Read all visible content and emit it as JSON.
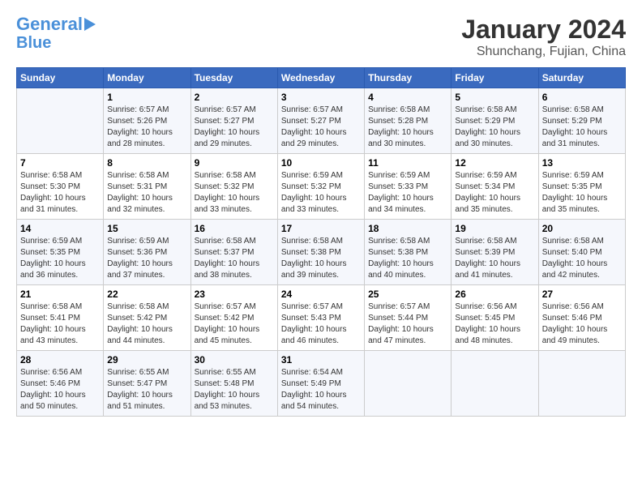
{
  "logo": {
    "line1": "General",
    "line2": "Blue"
  },
  "title": "January 2024",
  "subtitle": "Shunchang, Fujian, China",
  "days_header": [
    "Sunday",
    "Monday",
    "Tuesday",
    "Wednesday",
    "Thursday",
    "Friday",
    "Saturday"
  ],
  "weeks": [
    [
      {
        "num": "",
        "info": ""
      },
      {
        "num": "1",
        "info": "Sunrise: 6:57 AM\nSunset: 5:26 PM\nDaylight: 10 hours\nand 28 minutes."
      },
      {
        "num": "2",
        "info": "Sunrise: 6:57 AM\nSunset: 5:27 PM\nDaylight: 10 hours\nand 29 minutes."
      },
      {
        "num": "3",
        "info": "Sunrise: 6:57 AM\nSunset: 5:27 PM\nDaylight: 10 hours\nand 29 minutes."
      },
      {
        "num": "4",
        "info": "Sunrise: 6:58 AM\nSunset: 5:28 PM\nDaylight: 10 hours\nand 30 minutes."
      },
      {
        "num": "5",
        "info": "Sunrise: 6:58 AM\nSunset: 5:29 PM\nDaylight: 10 hours\nand 30 minutes."
      },
      {
        "num": "6",
        "info": "Sunrise: 6:58 AM\nSunset: 5:29 PM\nDaylight: 10 hours\nand 31 minutes."
      }
    ],
    [
      {
        "num": "7",
        "info": "Sunrise: 6:58 AM\nSunset: 5:30 PM\nDaylight: 10 hours\nand 31 minutes."
      },
      {
        "num": "8",
        "info": "Sunrise: 6:58 AM\nSunset: 5:31 PM\nDaylight: 10 hours\nand 32 minutes."
      },
      {
        "num": "9",
        "info": "Sunrise: 6:58 AM\nSunset: 5:32 PM\nDaylight: 10 hours\nand 33 minutes."
      },
      {
        "num": "10",
        "info": "Sunrise: 6:59 AM\nSunset: 5:32 PM\nDaylight: 10 hours\nand 33 minutes."
      },
      {
        "num": "11",
        "info": "Sunrise: 6:59 AM\nSunset: 5:33 PM\nDaylight: 10 hours\nand 34 minutes."
      },
      {
        "num": "12",
        "info": "Sunrise: 6:59 AM\nSunset: 5:34 PM\nDaylight: 10 hours\nand 35 minutes."
      },
      {
        "num": "13",
        "info": "Sunrise: 6:59 AM\nSunset: 5:35 PM\nDaylight: 10 hours\nand 35 minutes."
      }
    ],
    [
      {
        "num": "14",
        "info": "Sunrise: 6:59 AM\nSunset: 5:35 PM\nDaylight: 10 hours\nand 36 minutes."
      },
      {
        "num": "15",
        "info": "Sunrise: 6:59 AM\nSunset: 5:36 PM\nDaylight: 10 hours\nand 37 minutes."
      },
      {
        "num": "16",
        "info": "Sunrise: 6:58 AM\nSunset: 5:37 PM\nDaylight: 10 hours\nand 38 minutes."
      },
      {
        "num": "17",
        "info": "Sunrise: 6:58 AM\nSunset: 5:38 PM\nDaylight: 10 hours\nand 39 minutes."
      },
      {
        "num": "18",
        "info": "Sunrise: 6:58 AM\nSunset: 5:38 PM\nDaylight: 10 hours\nand 40 minutes."
      },
      {
        "num": "19",
        "info": "Sunrise: 6:58 AM\nSunset: 5:39 PM\nDaylight: 10 hours\nand 41 minutes."
      },
      {
        "num": "20",
        "info": "Sunrise: 6:58 AM\nSunset: 5:40 PM\nDaylight: 10 hours\nand 42 minutes."
      }
    ],
    [
      {
        "num": "21",
        "info": "Sunrise: 6:58 AM\nSunset: 5:41 PM\nDaylight: 10 hours\nand 43 minutes."
      },
      {
        "num": "22",
        "info": "Sunrise: 6:58 AM\nSunset: 5:42 PM\nDaylight: 10 hours\nand 44 minutes."
      },
      {
        "num": "23",
        "info": "Sunrise: 6:57 AM\nSunset: 5:42 PM\nDaylight: 10 hours\nand 45 minutes."
      },
      {
        "num": "24",
        "info": "Sunrise: 6:57 AM\nSunset: 5:43 PM\nDaylight: 10 hours\nand 46 minutes."
      },
      {
        "num": "25",
        "info": "Sunrise: 6:57 AM\nSunset: 5:44 PM\nDaylight: 10 hours\nand 47 minutes."
      },
      {
        "num": "26",
        "info": "Sunrise: 6:56 AM\nSunset: 5:45 PM\nDaylight: 10 hours\nand 48 minutes."
      },
      {
        "num": "27",
        "info": "Sunrise: 6:56 AM\nSunset: 5:46 PM\nDaylight: 10 hours\nand 49 minutes."
      }
    ],
    [
      {
        "num": "28",
        "info": "Sunrise: 6:56 AM\nSunset: 5:46 PM\nDaylight: 10 hours\nand 50 minutes."
      },
      {
        "num": "29",
        "info": "Sunrise: 6:55 AM\nSunset: 5:47 PM\nDaylight: 10 hours\nand 51 minutes."
      },
      {
        "num": "30",
        "info": "Sunrise: 6:55 AM\nSunset: 5:48 PM\nDaylight: 10 hours\nand 53 minutes."
      },
      {
        "num": "31",
        "info": "Sunrise: 6:54 AM\nSunset: 5:49 PM\nDaylight: 10 hours\nand 54 minutes."
      },
      {
        "num": "",
        "info": ""
      },
      {
        "num": "",
        "info": ""
      },
      {
        "num": "",
        "info": ""
      }
    ]
  ]
}
